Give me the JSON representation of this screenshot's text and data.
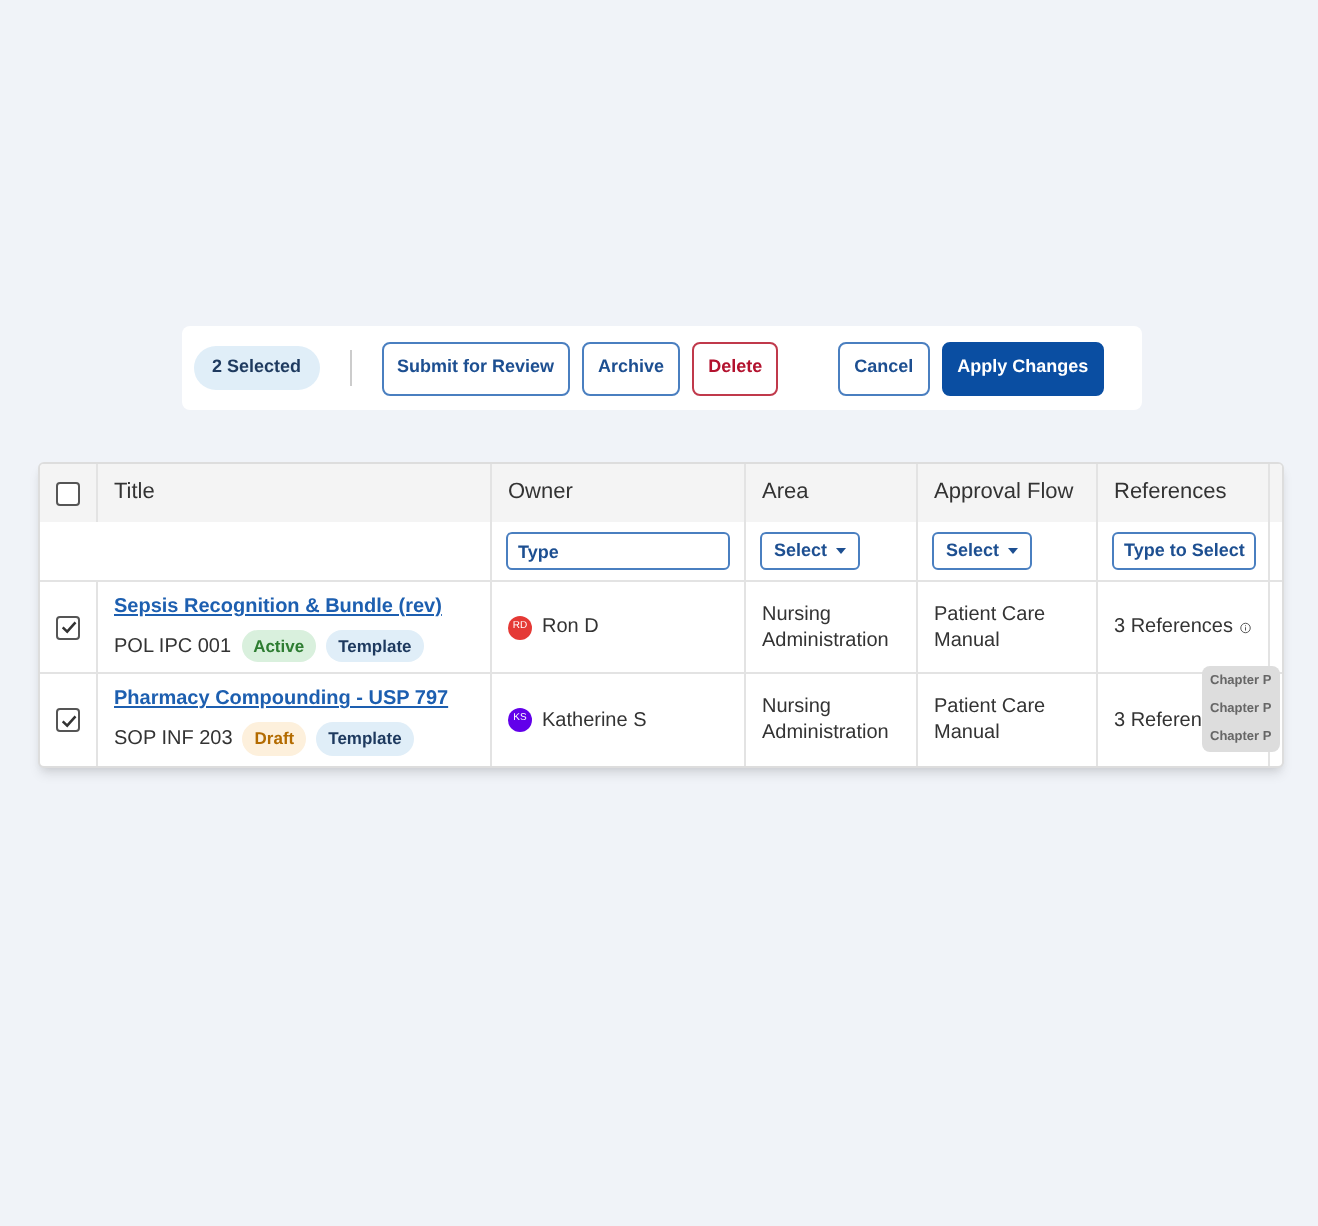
{
  "toolbar": {
    "selected_count": "2 Selected",
    "buttons": [
      {
        "label": "Submit for Review",
        "kind": "outline"
      },
      {
        "label": "Archive",
        "kind": "outline"
      },
      {
        "label": "Delete",
        "kind": "danger"
      },
      {
        "label": "Cancel",
        "kind": "outline"
      },
      {
        "label": "Apply Changes",
        "kind": "primary"
      }
    ]
  },
  "table": {
    "select_all": {
      "checked": false
    },
    "columns": [
      {
        "label": "Title"
      },
      {
        "label": "Owner",
        "filter": {
          "kind": "input",
          "placeholder": "Type"
        }
      },
      {
        "label": "Area",
        "filter": {
          "kind": "select",
          "label": "Select"
        }
      },
      {
        "label": "Approval Flow",
        "filter": {
          "kind": "select",
          "label": "Select"
        }
      },
      {
        "label": "References",
        "filter": {
          "kind": "button",
          "label": "Type to Select"
        }
      }
    ],
    "rows": [
      {
        "checked": true,
        "title": "Sepsis Recognition & Bundle (rev)",
        "code": "POL IPC 001",
        "tags": [
          {
            "label": "Active",
            "kind": "active"
          },
          {
            "label": "Template",
            "kind": "template"
          }
        ],
        "owner": {
          "initials": "RD",
          "name": "Ron D",
          "color": "#e53935"
        },
        "area": "Nursing Administration",
        "approval_flow": "Patient Care Manual",
        "references": "3 References",
        "info_icon": true
      },
      {
        "checked": true,
        "title": "Pharmacy Compounding - USP 797",
        "code": "SOP INF 203",
        "tags": [
          {
            "label": "Draft",
            "kind": "draft"
          },
          {
            "label": "Template",
            "kind": "template"
          }
        ],
        "owner": {
          "initials": "KS",
          "name": "Katherine S",
          "color": "#6200ea"
        },
        "area": "Nursing Administration",
        "approval_flow": "Patient Care Manual",
        "references": "3 Referen",
        "info_icon": false
      }
    ],
    "tooltip": {
      "items": [
        "Chapter P",
        "Chapter P",
        "Chapter P"
      ]
    }
  }
}
